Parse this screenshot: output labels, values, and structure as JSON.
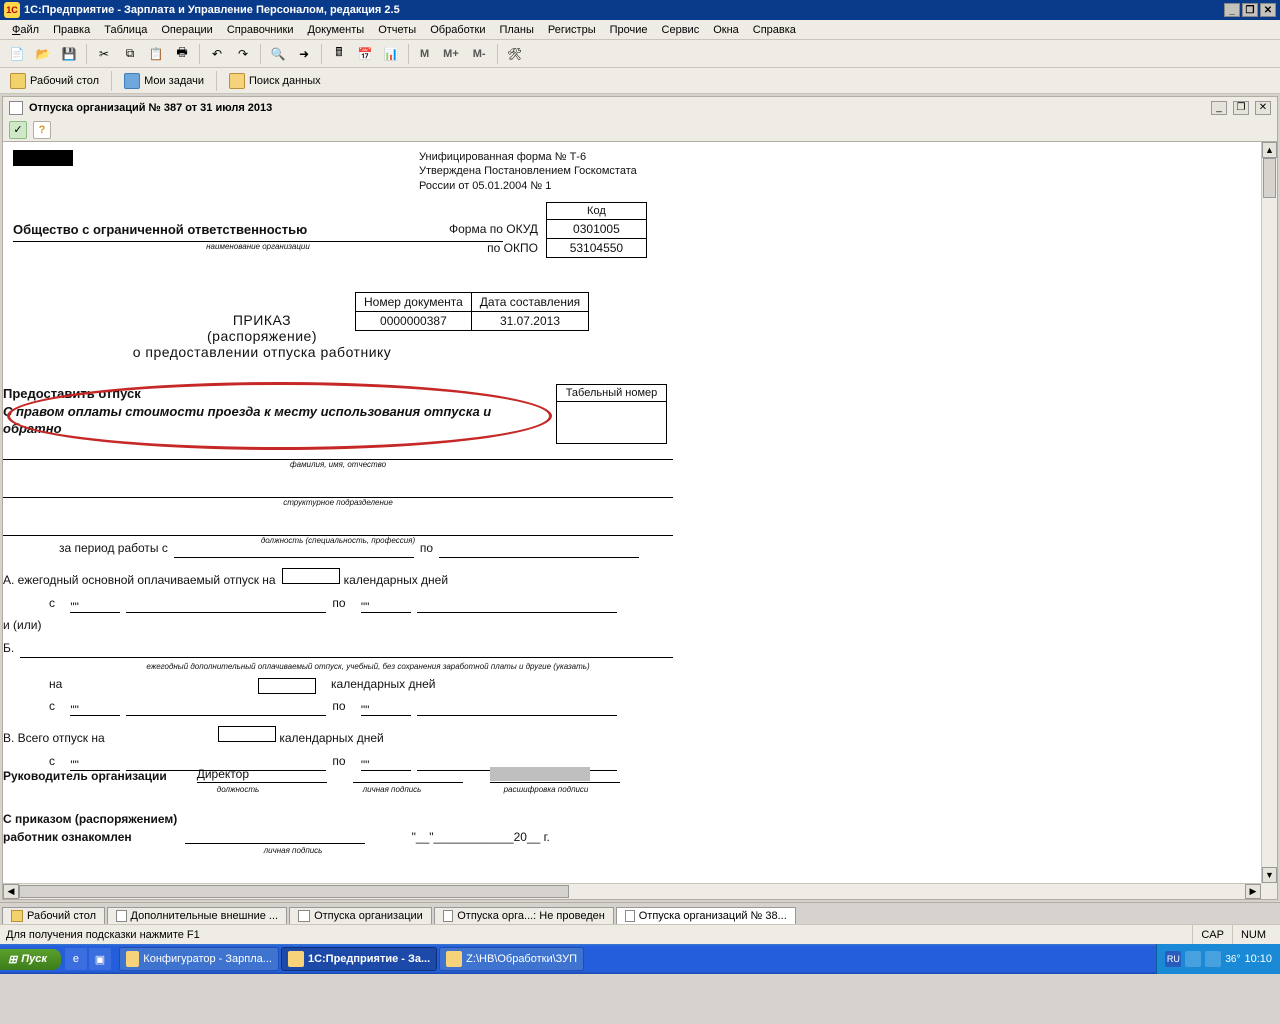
{
  "window": {
    "title": "1С:Предприятие - Зарплата и Управление Персоналом, редакция 2.5"
  },
  "menubar": {
    "file": "Файл",
    "edit": "Правка",
    "table": "Таблица",
    "ops": "Операции",
    "refs": "Справочники",
    "docs": "Документы",
    "reports": "Отчеты",
    "proc": "Обработки",
    "plans": "Планы",
    "reg": "Регистры",
    "other": "Прочие",
    "svc": "Сервис",
    "win": "Окна",
    "help": "Справка"
  },
  "toolbar": {
    "m": "M",
    "mplus": "M+",
    "mminus": "M-"
  },
  "toolbar2": {
    "desktop": "Рабочий стол",
    "tasks": "Мои задачи",
    "search": "Поиск данных"
  },
  "doctab": {
    "title": "Отпуска организаций № 387 от 31 июля 2013"
  },
  "form": {
    "hdr1": "Унифицированная форма № Т-6",
    "hdr2": "Утверждена Постановлением Госкомстата",
    "hdr3": "России от 05.01.2004 № 1",
    "codehdr": "Код",
    "okud_lbl": "Форма по ОКУД",
    "okud": "0301005",
    "okpo_lbl": "по ОКПО",
    "okpo": "53104550",
    "org": "Общество с ограниченной ответственностью",
    "org_sub": "наименование организации",
    "docnum_lbl": "Номер документа",
    "docnum": "0000000387",
    "date_lbl": "Дата составления",
    "date": "31.07.2013",
    "order": "ПРИКАЗ",
    "order2": "(распоряжение)",
    "order3": "о предоставлении отпуска работнику",
    "grant": "Предоставить отпуск",
    "highlight": "С правом оплаты стоимости проезда к месту использования отпуска и обратно",
    "tabnum": "Табельный номер",
    "fio": "фамилия, имя, отчество",
    "dept": "структурное подразделение",
    "pos": "должность (специальность, профессия)",
    "period": "за период работы с",
    "po": "по",
    "a": "А. ежегодный основной оплачиваемый отпуск на",
    "days": "календарных дней",
    "s": "с",
    "q": "\"\"",
    "andor": "и (или)",
    "b": "Б.",
    "b_sub": "ежегодный дополнительный оплачиваемый отпуск, учебный, без сохранения заработной платы и другие (указать)",
    "na": "на",
    "v": "В.    Всего отпуск на",
    "chief_lbl": "Руководитель организации",
    "chief_pos": "Директор",
    "pos_sub": "должность",
    "sign_sub": "личная подпись",
    "name_sub": "расшифровка подписи",
    "ack": "С приказом (распоряжением)",
    "ack2": "работник  ознакомлен",
    "date_fmt": "\"__\"____________20__ г."
  },
  "tabs": {
    "t1": "Рабочий стол",
    "t2": "Дополнительные внешние ...",
    "t3": "Отпуска организации",
    "t4": "Отпуска орга...: Не проведен",
    "t5": "Отпуска организаций № 38..."
  },
  "statusbar": {
    "hint": "Для получения подсказки нажмите F1",
    "cap": "CAP",
    "num": "NUM"
  },
  "taskbar": {
    "start": "Пуск",
    "t1": "Конфигуратор - Зарпла...",
    "t2": "1С:Предприятие - За...",
    "t3": "Z:\\НВ\\Обработки\\ЗУП",
    "lang": "RU",
    "temp": "36°",
    "time": "10:10"
  }
}
